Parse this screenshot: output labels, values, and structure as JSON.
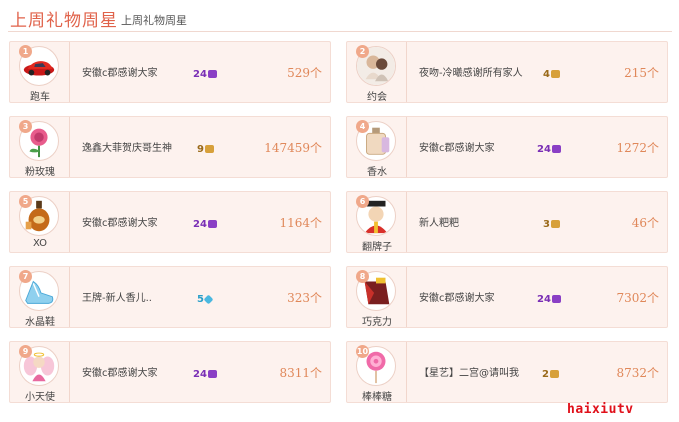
{
  "header": {
    "title": "上周礼物周星",
    "subtitle": "上周礼物周星"
  },
  "entries": [
    {
      "rank": "1",
      "gift": "跑车",
      "gift_icon": "sports-car",
      "user": "安徽c郡感谢大家",
      "level": "24",
      "level_color": "#7a2fb5",
      "count": "529个"
    },
    {
      "rank": "2",
      "gift": "约会",
      "gift_icon": "dating-couple",
      "user": "夜吻-冷曦感谢所有家人",
      "level": "4",
      "level_color": "#9a6a1a",
      "count": "215个"
    },
    {
      "rank": "3",
      "gift": "粉玫瑰",
      "gift_icon": "pink-rose",
      "user": "逸鑫大菲贺庆哥生神",
      "level": "9",
      "level_color": "#9a6a1a",
      "count": "147459个"
    },
    {
      "rank": "4",
      "gift": "香水",
      "gift_icon": "perfume",
      "user": "安徽c郡感谢大家",
      "level": "24",
      "level_color": "#7a2fb5",
      "count": "1272个"
    },
    {
      "rank": "5",
      "gift": "XO",
      "gift_icon": "xo-bottle",
      "user": "安徽c郡感谢大家",
      "level": "24",
      "level_color": "#7a2fb5",
      "count": "1164个"
    },
    {
      "rank": "6",
      "gift": "翻牌子",
      "gift_icon": "emperor",
      "user": "新人粑粑",
      "level": "3",
      "level_color": "#9a6a1a",
      "count": "46个"
    },
    {
      "rank": "7",
      "gift": "水晶鞋",
      "gift_icon": "crystal-shoe",
      "user": "王牌-新人香儿..",
      "level": "5",
      "level_color": "#2a9fc9",
      "count": "323个"
    },
    {
      "rank": "8",
      "gift": "巧克力",
      "gift_icon": "chocolate",
      "user": "安徽c郡感谢大家",
      "level": "24",
      "level_color": "#7a2fb5",
      "count": "7302个"
    },
    {
      "rank": "9",
      "gift": "小天使",
      "gift_icon": "little-angel",
      "user": "安徽c郡感谢大家",
      "level": "24",
      "level_color": "#7a2fb5",
      "count": "8311个"
    },
    {
      "rank": "10",
      "gift": "棒棒糖",
      "gift_icon": "lollipop",
      "user": "【星艺】二宫@请叫我",
      "level": "2",
      "level_color": "#9a6a1a",
      "count": "8732个"
    }
  ],
  "watermark": "haixiutv",
  "colors": {
    "accent": "#e0624a",
    "card_bg": "#fdf2ee",
    "count": "#e0885a",
    "rank_badge": "#f0a88a",
    "watermark": "#e0101a"
  }
}
